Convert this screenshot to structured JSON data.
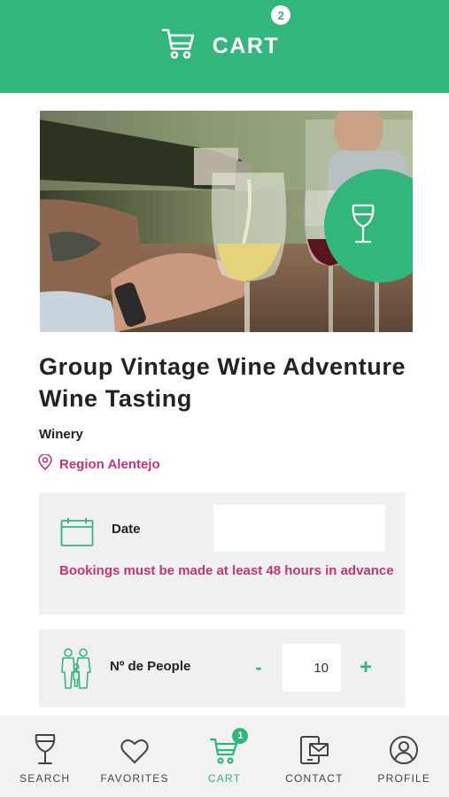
{
  "header": {
    "title": "CART",
    "badge_count": "2",
    "icon": "cart-icon"
  },
  "hero": {
    "image_description": "wine being poured into glass",
    "badge_icon": "wine-glass-icon"
  },
  "product": {
    "title": "Group Vintage Wine Adventure Wine Tasting",
    "category": "Winery",
    "location": "Region Alentejo"
  },
  "booking": {
    "date_label": "Date",
    "date_value": "",
    "notice": "Bookings must be made at least 48 hours in advance",
    "people_label": "Nº de People",
    "people_value": "10",
    "minus_label": "-",
    "plus_label": "+"
  },
  "tabbar": {
    "items": [
      {
        "label": "SEARCH",
        "icon": "wine-glass-icon"
      },
      {
        "label": "FAVORITES",
        "icon": "heart-icon"
      },
      {
        "label": "CART",
        "icon": "cart-icon",
        "badge": "1",
        "active": true
      },
      {
        "label": "CONTACT",
        "icon": "contact-icon"
      },
      {
        "label": "PROFILE",
        "icon": "profile-icon"
      }
    ]
  },
  "colors": {
    "accent": "#33b67c",
    "highlight": "#c2357a",
    "panel": "#f0f0f0"
  }
}
